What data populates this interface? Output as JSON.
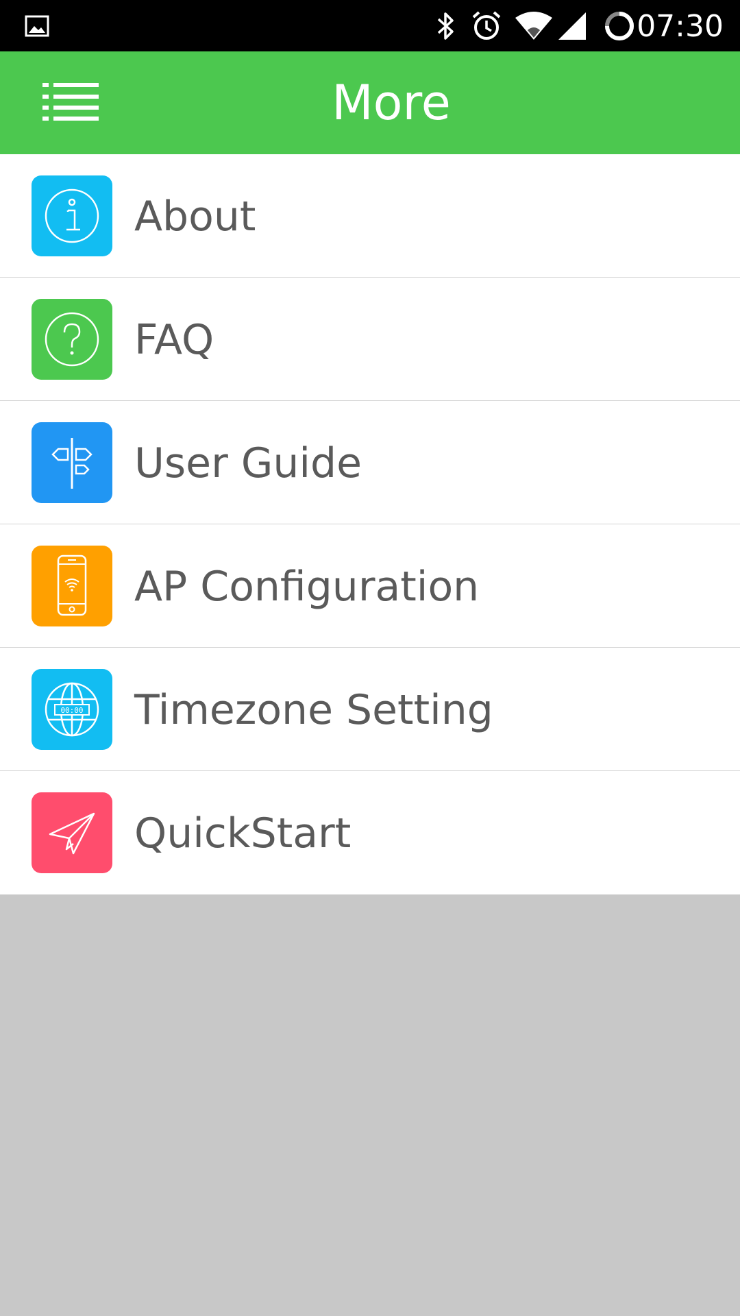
{
  "status_bar": {
    "time": "07:30",
    "icons": [
      "image-notification-icon",
      "bluetooth-icon",
      "alarm-icon",
      "wifi-icon",
      "cell-signal-icon",
      "sync-icon"
    ]
  },
  "app_bar": {
    "title": "More",
    "menu_icon": "list-menu-icon",
    "background_color": "#4cc84f"
  },
  "menu": {
    "items": [
      {
        "label": "About",
        "icon": "info-icon",
        "color": "#12bdf2"
      },
      {
        "label": "FAQ",
        "icon": "question-icon",
        "color": "#4cc84f"
      },
      {
        "label": "User Guide",
        "icon": "signpost-icon",
        "color": "#2196f3"
      },
      {
        "label": "AP Configuration",
        "icon": "phone-wifi-icon",
        "color": "#ffa000"
      },
      {
        "label": "Timezone Setting",
        "icon": "globe-clock-icon",
        "color": "#12bdf2"
      },
      {
        "label": "QuickStart",
        "icon": "paper-plane-icon",
        "color": "#ff4d6d"
      }
    ]
  }
}
